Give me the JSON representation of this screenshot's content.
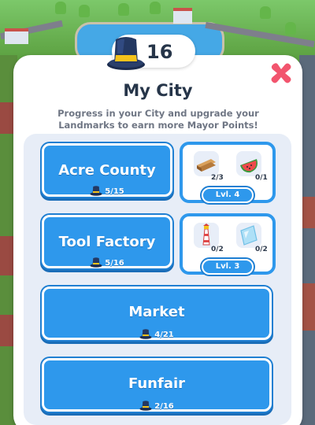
{
  "header": {
    "points": "16",
    "title": "My City",
    "subtitle": "Progress in your City and upgrade your Landmarks to earn more Mayor Points!"
  },
  "icons": {
    "hat": "top-hat-icon",
    "close": "close-x-icon",
    "wood": "wood-planks-icon",
    "watermelon": "watermelon-icon",
    "lighthouse": "lighthouse-icon",
    "glass": "glass-panel-icon"
  },
  "colors": {
    "button_blue": "#2e98ec",
    "close_pink": "#f2556e",
    "panel_bg": "#ffffff",
    "list_bg": "#e7edf7"
  },
  "areas": [
    {
      "name": "Acre County",
      "progress": "5/15",
      "landmark": {
        "items": [
          {
            "icon": "wood-planks-icon",
            "count": "2/3"
          },
          {
            "icon": "watermelon-icon",
            "count": "0/1"
          }
        ],
        "level": "Lvl. 4"
      }
    },
    {
      "name": "Tool Factory",
      "progress": "5/16",
      "landmark": {
        "items": [
          {
            "icon": "lighthouse-icon",
            "count": "0/2"
          },
          {
            "icon": "glass-panel-icon",
            "count": "0/2"
          }
        ],
        "level": "Lvl. 3"
      }
    },
    {
      "name": "Market",
      "progress": "4/21"
    },
    {
      "name": "Funfair",
      "progress": "2/16"
    }
  ]
}
